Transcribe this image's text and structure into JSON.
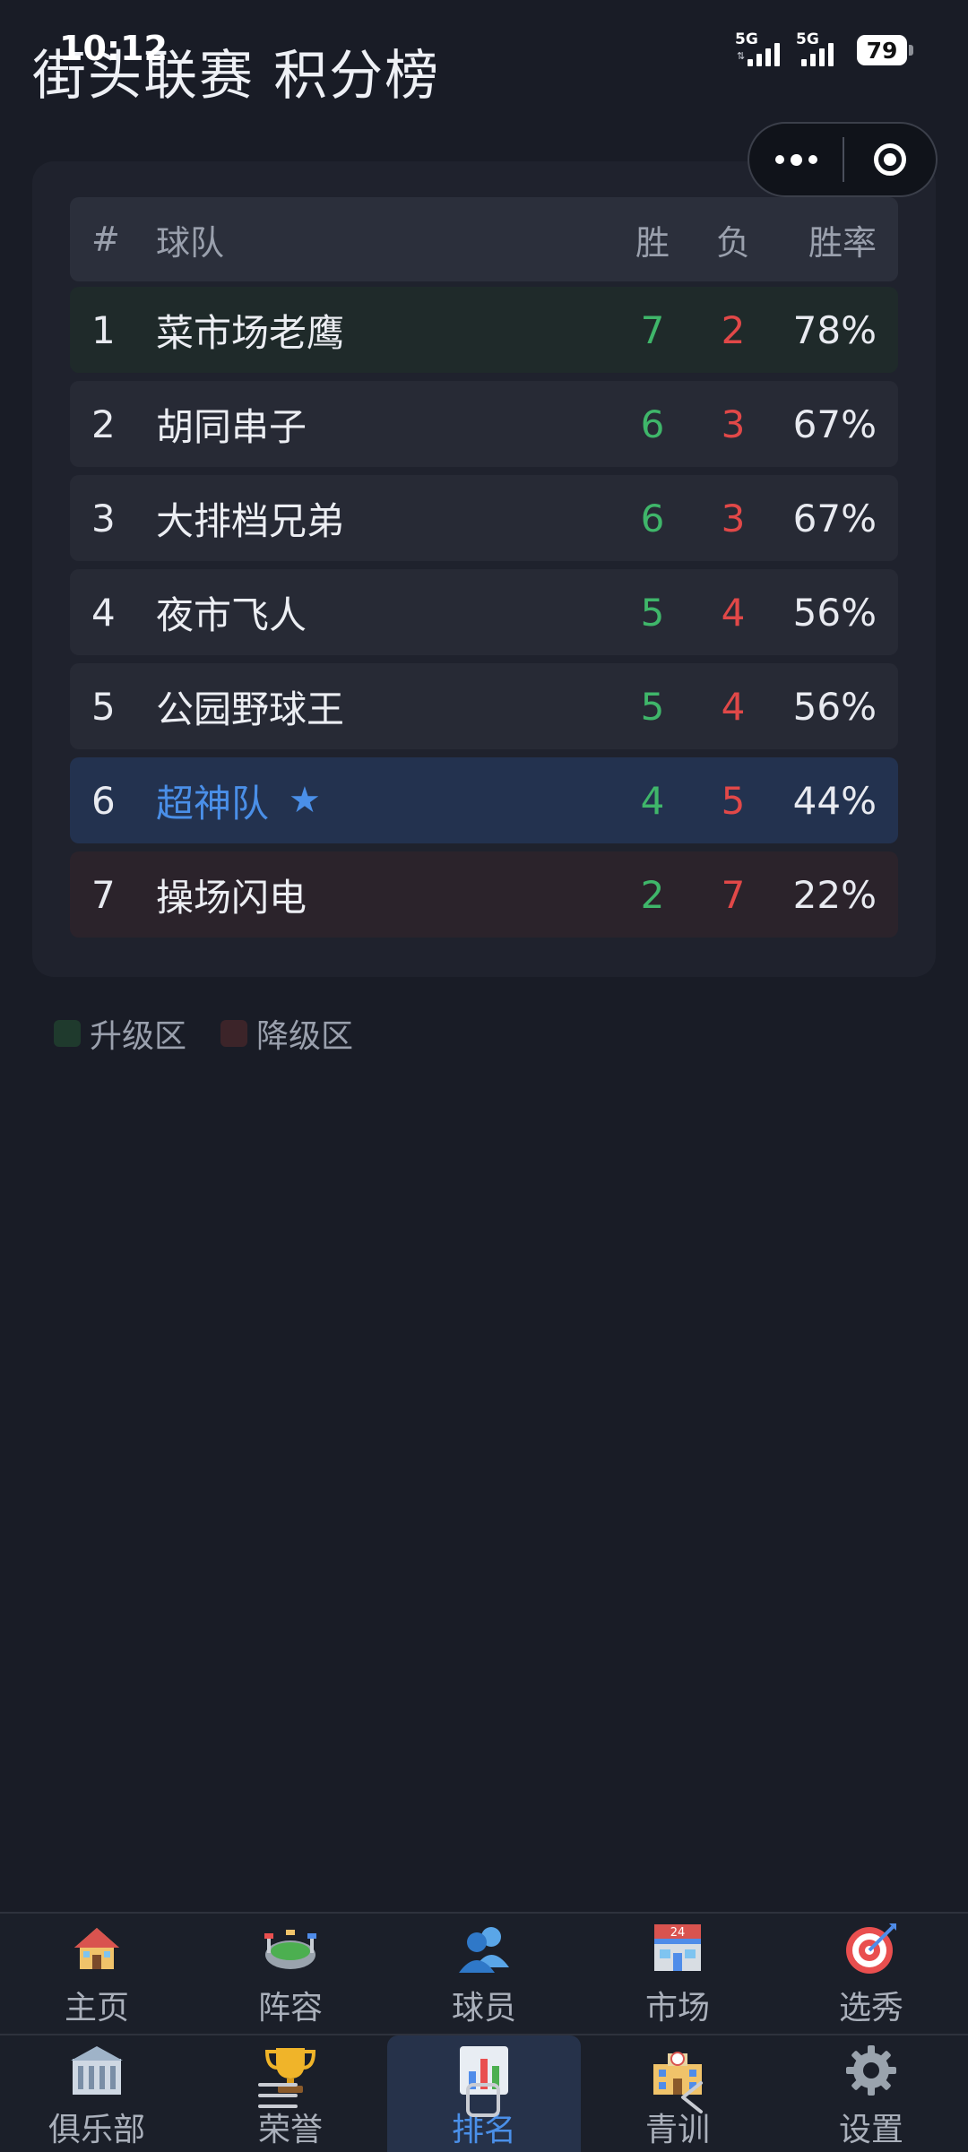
{
  "status_bar": {
    "time": "10:12",
    "network_1": "5G",
    "network_2": "5G",
    "battery": "79"
  },
  "header": {
    "title": "街头联赛 积分榜"
  },
  "table": {
    "headers": {
      "rank": "#",
      "team": "球队",
      "wins": "胜",
      "losses": "负",
      "win_rate": "胜率"
    },
    "rows": [
      {
        "rank": "1",
        "team": "菜市场老鹰",
        "wins": "7",
        "losses": "2",
        "win_rate": "78%",
        "zone": "promote"
      },
      {
        "rank": "2",
        "team": "胡同串子",
        "wins": "6",
        "losses": "3",
        "win_rate": "67%",
        "zone": ""
      },
      {
        "rank": "3",
        "team": "大排档兄弟",
        "wins": "6",
        "losses": "3",
        "win_rate": "67%",
        "zone": ""
      },
      {
        "rank": "4",
        "team": "夜市飞人",
        "wins": "5",
        "losses": "4",
        "win_rate": "56%",
        "zone": ""
      },
      {
        "rank": "5",
        "team": "公园野球王",
        "wins": "5",
        "losses": "4",
        "win_rate": "56%",
        "zone": ""
      },
      {
        "rank": "6",
        "team": "超神队",
        "wins": "4",
        "losses": "5",
        "win_rate": "44%",
        "zone": "mine"
      },
      {
        "rank": "7",
        "team": "操场闪电",
        "wins": "2",
        "losses": "7",
        "win_rate": "22%",
        "zone": "relegate"
      }
    ],
    "my_team_marker": "★"
  },
  "legend": {
    "promote_label": "升级区",
    "relegate_label": "降级区"
  },
  "bottom_nav": {
    "row1": [
      {
        "label": "主页",
        "icon": "house-icon"
      },
      {
        "label": "阵容",
        "icon": "stadium-icon"
      },
      {
        "label": "球员",
        "icon": "players-icon"
      },
      {
        "label": "市场",
        "icon": "store-icon"
      },
      {
        "label": "选秀",
        "icon": "target-icon"
      }
    ],
    "row2": [
      {
        "label": "俱乐部",
        "icon": "building-icon"
      },
      {
        "label": "荣誉",
        "icon": "trophy-icon"
      },
      {
        "label": "排名",
        "icon": "bar-chart-icon",
        "active": true
      },
      {
        "label": "青训",
        "icon": "school-icon"
      },
      {
        "label": "设置",
        "icon": "gear-icon"
      }
    ]
  },
  "colors": {
    "background": "#191c26",
    "card": "#1f222d",
    "win": "#3fb66a",
    "loss": "#e14848",
    "accent": "#4a8fe8",
    "promote_zone": "#1f2a2a",
    "relegate_zone": "#2b232b"
  }
}
